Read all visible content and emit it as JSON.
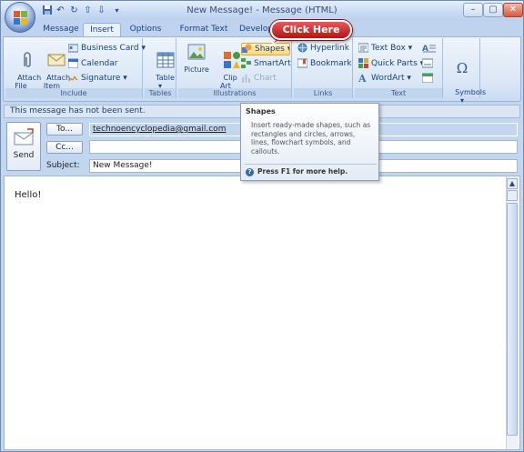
{
  "window": {
    "title": "New Message! - Message (HTML)",
    "minimize_label": "–",
    "maximize_label": "▢",
    "close_label": "✕"
  },
  "quick_access": [
    "save-icon",
    "undo-icon",
    "redo-icon",
    "up-arrow-icon",
    "down-arrow-icon",
    "customize-icon"
  ],
  "tabs": [
    {
      "label": "Message",
      "active": false
    },
    {
      "label": "Insert",
      "active": true
    },
    {
      "label": "Options",
      "active": false
    },
    {
      "label": "Format Text",
      "active": false
    },
    {
      "label": "Develop",
      "active": false
    }
  ],
  "ribbon": {
    "include": {
      "label": "Include",
      "attach_file": "Attach\nFile",
      "attach_item": "Attach\nItem",
      "business_card": "Business Card ▾",
      "calendar": "Calendar",
      "signature": "Signature ▾"
    },
    "tables": {
      "label": "Tables",
      "table": "Table\n▾"
    },
    "illustrations": {
      "label": "Illustrations",
      "picture": "Picture",
      "clip_art": "Clip\nArt",
      "shapes": "Shapes ▾",
      "smartart": "SmartArt",
      "chart": "Chart"
    },
    "links": {
      "label": "Links",
      "hyperlink": "Hyperlink",
      "bookmark": "Bookmark"
    },
    "text": {
      "label": "Text",
      "text_box": "Text Box ▾",
      "quick_parts": "Quick Parts ▾",
      "wordart": "WordArt ▾"
    },
    "symbols": {
      "label": "Symbols",
      "symbols": "Symbols\n▾"
    }
  },
  "infobar": "This message has not been sent.",
  "compose": {
    "send_label": "Send",
    "to_label": "To...",
    "to_value": "technoencyclopedia@gmail.com",
    "cc_label": "Cc...",
    "cc_value": "",
    "subject_label": "Subject:",
    "subject_value": "New Message!",
    "body_text": "Hello!"
  },
  "tooltip": {
    "title": "Shapes",
    "description": "Insert ready-made shapes, such as rectangles and circles, arrows, lines, flowchart symbols, and callouts.",
    "help": "Press F1 for more help."
  },
  "callout": "Click Here",
  "colors": {
    "accent": "#15428b",
    "callout": "#c51f1f",
    "ribbon": "#dbe7f7"
  }
}
